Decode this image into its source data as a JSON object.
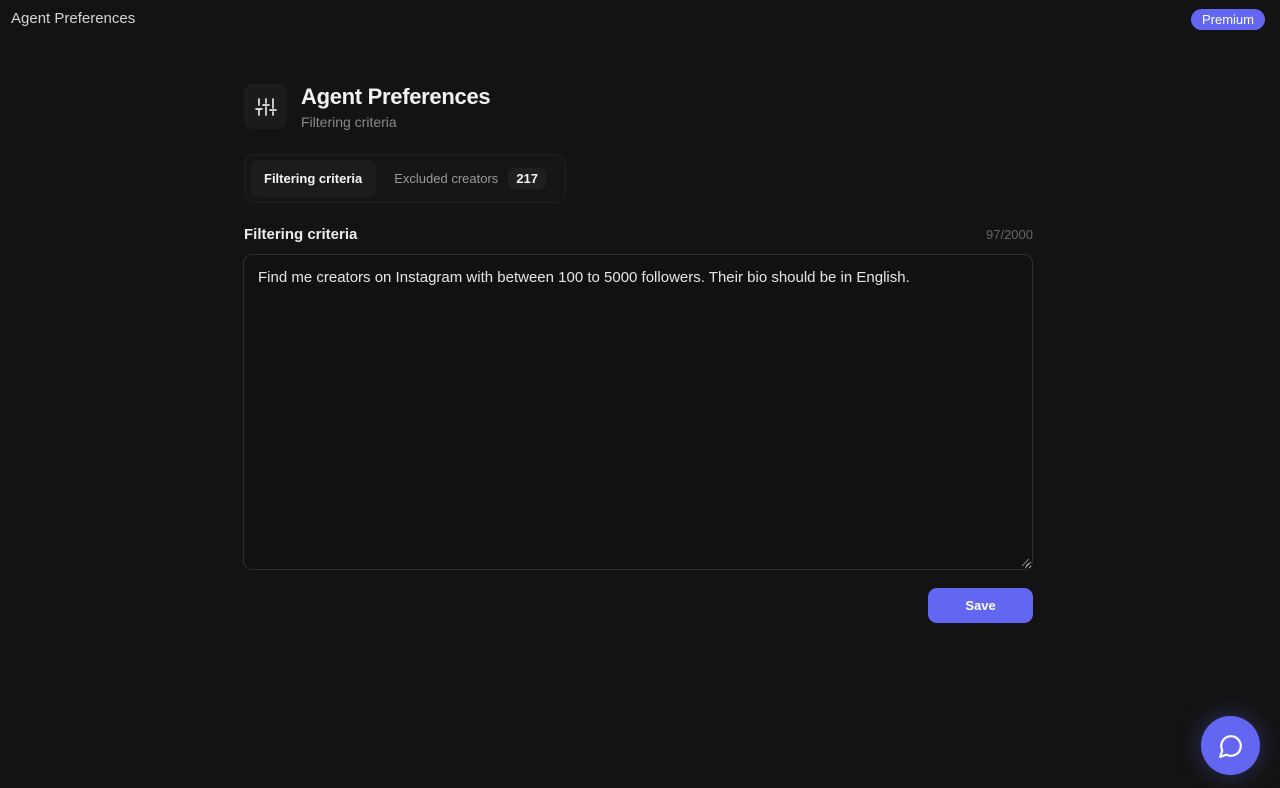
{
  "topbar": {
    "title": "Agent Preferences",
    "premium_label": "Premium"
  },
  "header": {
    "icon": "sliders-icon",
    "title": "Agent Preferences",
    "subtitle": "Filtering criteria"
  },
  "tabs": [
    {
      "label": "Filtering criteria",
      "active": true
    },
    {
      "label": "Excluded creators",
      "count": "217",
      "active": false
    }
  ],
  "criteria": {
    "label": "Filtering criteria",
    "char_count": "97/2000",
    "value": "Find me creators on Instagram with between 100 to 5000 followers. Their bio should be in English."
  },
  "actions": {
    "save_label": "Save"
  },
  "chat": {
    "icon": "chat-bubble-icon"
  },
  "colors": {
    "background": "#131313",
    "accent": "#6366f1"
  }
}
